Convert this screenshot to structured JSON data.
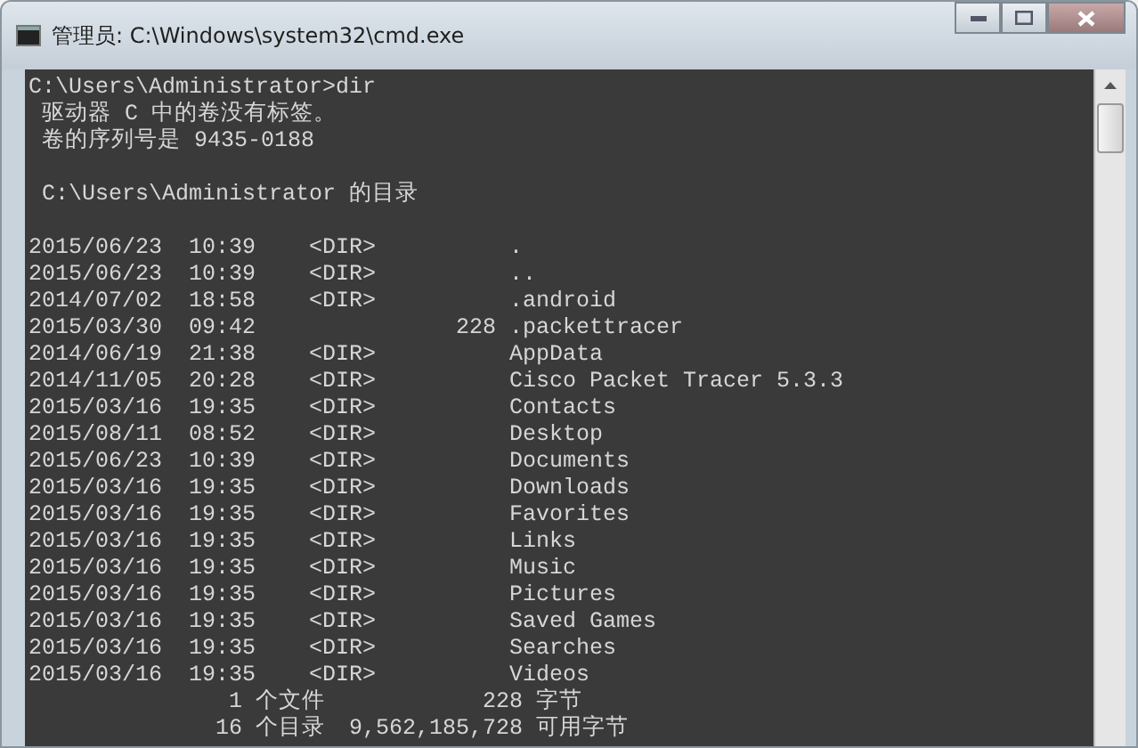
{
  "window": {
    "title": "管理员: C:\\Windows\\system32\\cmd.exe"
  },
  "console": {
    "prompt": "C:\\Users\\Administrator>dir",
    "volume_lines": [
      "驱动器 C 中的卷没有标签。",
      "卷的序列号是 9435-0188"
    ],
    "directory_line": "C:\\Users\\Administrator 的目录",
    "entries": [
      {
        "date": "2015/06/23",
        "time": "10:39",
        "kind": "dir",
        "type": "<DIR>",
        "name": "."
      },
      {
        "date": "2015/06/23",
        "time": "10:39",
        "kind": "dir",
        "type": "<DIR>",
        "name": ".."
      },
      {
        "date": "2014/07/02",
        "time": "18:58",
        "kind": "dir",
        "type": "<DIR>",
        "name": ".android"
      },
      {
        "date": "2015/03/30",
        "time": "09:42",
        "kind": "file",
        "size": "228",
        "name": ".packettracer"
      },
      {
        "date": "2014/06/19",
        "time": "21:38",
        "kind": "dir",
        "type": "<DIR>",
        "name": "AppData"
      },
      {
        "date": "2014/11/05",
        "time": "20:28",
        "kind": "dir",
        "type": "<DIR>",
        "name": "Cisco Packet Tracer 5.3.3"
      },
      {
        "date": "2015/03/16",
        "time": "19:35",
        "kind": "dir",
        "type": "<DIR>",
        "name": "Contacts"
      },
      {
        "date": "2015/08/11",
        "time": "08:52",
        "kind": "dir",
        "type": "<DIR>",
        "name": "Desktop"
      },
      {
        "date": "2015/06/23",
        "time": "10:39",
        "kind": "dir",
        "type": "<DIR>",
        "name": "Documents"
      },
      {
        "date": "2015/03/16",
        "time": "19:35",
        "kind": "dir",
        "type": "<DIR>",
        "name": "Downloads"
      },
      {
        "date": "2015/03/16",
        "time": "19:35",
        "kind": "dir",
        "type": "<DIR>",
        "name": "Favorites"
      },
      {
        "date": "2015/03/16",
        "time": "19:35",
        "kind": "dir",
        "type": "<DIR>",
        "name": "Links"
      },
      {
        "date": "2015/03/16",
        "time": "19:35",
        "kind": "dir",
        "type": "<DIR>",
        "name": "Music"
      },
      {
        "date": "2015/03/16",
        "time": "19:35",
        "kind": "dir",
        "type": "<DIR>",
        "name": "Pictures"
      },
      {
        "date": "2015/03/16",
        "time": "19:35",
        "kind": "dir",
        "type": "<DIR>",
        "name": "Saved Games"
      },
      {
        "date": "2015/03/16",
        "time": "19:35",
        "kind": "dir",
        "type": "<DIR>",
        "name": "Searches"
      },
      {
        "date": "2015/03/16",
        "time": "19:35",
        "kind": "dir",
        "type": "<DIR>",
        "name": "Videos"
      }
    ],
    "summary": [
      {
        "count": "1",
        "label": "个文件",
        "bytes": "228",
        "unit": "字节"
      },
      {
        "count": "16",
        "label": "个目录",
        "bytes": "9,562,185,728",
        "unit": "可用字节"
      }
    ]
  }
}
